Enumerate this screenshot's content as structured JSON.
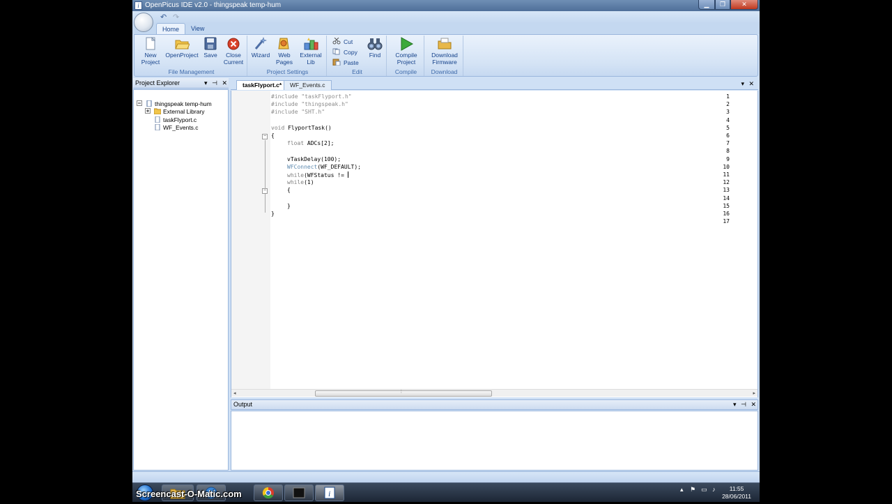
{
  "window": {
    "title": "OpenPicus IDE v2.0 - thingspeak temp-hum",
    "min_glyph": "▁",
    "max_glyph": "❐",
    "close_glyph": "✕"
  },
  "qat": {
    "undo_glyph": "↶",
    "redo_glyph": "↷"
  },
  "ribbon": {
    "tabs": [
      {
        "label": "Home"
      },
      {
        "label": "View"
      }
    ],
    "groups": {
      "file": {
        "label": "File Management",
        "new_project": "New\nProject",
        "open_project": "OpenProject",
        "save": "Save",
        "close_current": "Close\nCurrent"
      },
      "settings": {
        "label": "Project Settings",
        "wizard": "Wizard",
        "web_pages": "Web\nPages",
        "external_lib": "External\nLib"
      },
      "edit": {
        "label": "Edit",
        "cut": "Cut",
        "copy": "Copy",
        "paste": "Paste",
        "find": "Find"
      },
      "compile": {
        "label": "Compile",
        "compile_project": "Compile\nProject"
      },
      "download": {
        "label": "Download",
        "download_firmware": "Download\nFirmware"
      }
    }
  },
  "explorer": {
    "title": "Project Explorer",
    "pane_buttons": [
      "▾",
      "⊣",
      "✕"
    ],
    "tree": {
      "root": "thingspeak temp-hum",
      "external_library": "External Library",
      "file1": "taskFlyport.c",
      "file2": "WF_Events.c"
    }
  },
  "editor": {
    "tabs": [
      {
        "label": "taskFlyport.c*"
      },
      {
        "label": "WF_Events.c"
      }
    ],
    "tab_buttons": [
      "▾",
      "✕"
    ],
    "line_numbers": [
      "1",
      "2",
      "3",
      "4",
      "5",
      "6",
      "7",
      "8",
      "9",
      "10",
      "11",
      "12",
      "13",
      "14",
      "15",
      "16",
      "17"
    ],
    "lines": {
      "l1": "#include \"taskFlyport.h\"",
      "l2": "#include \"thingspeak.h\"",
      "l3": "#include \"SHT.h\"",
      "l5_kw": "void",
      "l5_rest": " FlyportTask()",
      "l6": "{",
      "l7_kw": "float",
      "l7_rest": " ADCs[2];",
      "l9": "vTaskDelay(100);",
      "l10_fn": "WFConnect",
      "l10_rest": "(WF_DEFAULT);",
      "l11_kw": "while",
      "l11_rest": "(WFStatus != ",
      "l12_kw": "while",
      "l12_rest": "(1)",
      "l13": "{",
      "l15": "}",
      "l16": "}"
    },
    "fold_minus": "−",
    "scroll_left": "◂",
    "scroll_right": "▸",
    "scroll_grip": "⦙"
  },
  "output": {
    "title": "Output",
    "pane_buttons": [
      "▾",
      "⊣",
      "✕"
    ]
  },
  "taskbar": {
    "watermark": "Screencast-O-Matic.com",
    "tray_glyphs": [
      "▴",
      "⚑",
      "▭",
      "♪"
    ],
    "time": "11:55",
    "date": "28/06/2011"
  },
  "colors": {
    "ribbon_text": "#15428b",
    "window_frame": "#cfe0f5",
    "close_red": "#c0391f",
    "compile_green": "#3ca93c"
  }
}
